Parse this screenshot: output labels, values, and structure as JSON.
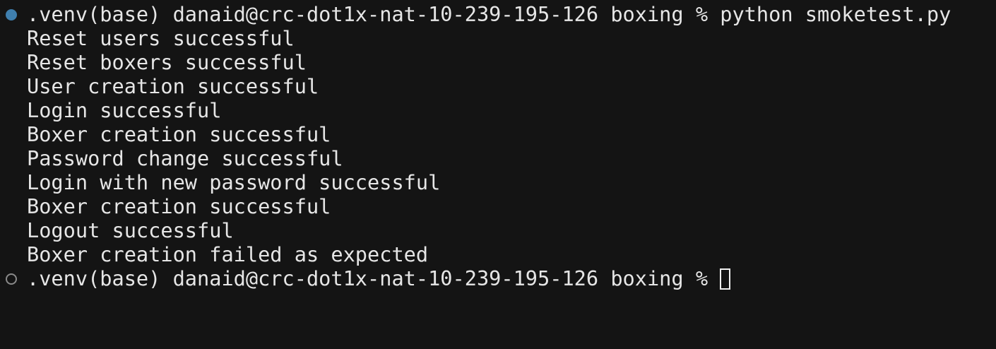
{
  "terminal": {
    "command_prompt": ".venv(base) danaid@crc-dot1x-nat-10-239-195-126 boxing % python smoketest.py",
    "output": [
      "Reset users successful",
      "Reset boxers successful",
      "User creation successful",
      "Login successful",
      "Boxer creation successful",
      "Password change successful",
      "Login with new password successful",
      "Boxer creation successful",
      "Logout successful",
      "Boxer creation failed as expected"
    ],
    "current_prompt": ".venv(base) danaid@crc-dot1x-nat-10-239-195-126 boxing % ",
    "indicator_colors": {
      "completed": "#3f7fae",
      "pending": "#8a8a8a"
    }
  }
}
